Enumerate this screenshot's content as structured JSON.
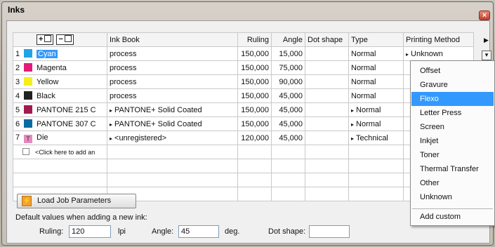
{
  "window": {
    "title": "Inks",
    "close_glyph": "×"
  },
  "toolbar": {
    "add_glyph": "+",
    "remove_glyph": "−"
  },
  "columns": {
    "ink_book": "Ink Book",
    "ruling": "Ruling",
    "angle": "Angle",
    "dot_shape": "Dot shape",
    "type": "Type",
    "printing_method": "Printing Method"
  },
  "inks": [
    {
      "num": "1",
      "name": "Cyan",
      "color": "#1fa4e6",
      "book": "process",
      "book_menu": false,
      "ruling": "150,000",
      "angle": "15,000",
      "dot_shape": "",
      "type": "Normal",
      "type_menu": false,
      "method": "Unknown",
      "method_menu": true,
      "selected": true
    },
    {
      "num": "2",
      "name": "Magenta",
      "color": "#e21b7a",
      "book": "process",
      "book_menu": false,
      "ruling": "150,000",
      "angle": "75,000",
      "dot_shape": "",
      "type": "Normal",
      "type_menu": false,
      "method": "",
      "method_menu": false,
      "selected": false
    },
    {
      "num": "3",
      "name": "Yellow",
      "color": "#f6ee1a",
      "book": "process",
      "book_menu": false,
      "ruling": "150,000",
      "angle": "90,000",
      "dot_shape": "",
      "type": "Normal",
      "type_menu": false,
      "method": "",
      "method_menu": false,
      "selected": false
    },
    {
      "num": "4",
      "name": "Black",
      "color": "#222222",
      "book": "process",
      "book_menu": false,
      "ruling": "150,000",
      "angle": "45,000",
      "dot_shape": "",
      "type": "Normal",
      "type_menu": false,
      "method": "",
      "method_menu": false,
      "selected": false
    },
    {
      "num": "5",
      "name": "PANTONE 215 C",
      "color": "#a31a52",
      "book": "PANTONE+ Solid Coated",
      "book_menu": true,
      "ruling": "150,000",
      "angle": "45,000",
      "dot_shape": "",
      "type": "Normal",
      "type_menu": true,
      "method": "",
      "method_menu": false,
      "selected": false
    },
    {
      "num": "6",
      "name": "PANTONE 307 C",
      "color": "#0a6ca3",
      "book": "PANTONE+ Solid Coated",
      "book_menu": true,
      "ruling": "150,000",
      "angle": "45,000",
      "dot_shape": "",
      "type": "Normal",
      "type_menu": true,
      "method": "",
      "method_menu": false,
      "selected": false
    },
    {
      "num": "7",
      "name": "Die",
      "color": "#e58ac0",
      "book": "<unregistered>",
      "book_menu": true,
      "ruling": "120,000",
      "angle": "45,000",
      "dot_shape": "",
      "type": "Technical",
      "type_menu": true,
      "method": "",
      "method_menu": false,
      "selected": false
    }
  ],
  "die_icon_glyph": "T",
  "add_row_hint": "<Click here to add an",
  "printing_method_menu": {
    "items": [
      "Offset",
      "Gravure",
      "Flexo",
      "Letter Press",
      "Screen",
      "Inkjet",
      "Toner",
      "Thermal Transfer",
      "Other",
      "Unknown"
    ],
    "highlighted": "Flexo",
    "add_custom": "Add custom"
  },
  "load_button": {
    "label": "Load Job Parameters",
    "icon": "lightning-icon",
    "glyph": "⚡"
  },
  "defaults": {
    "label": "Default values when adding a new ink:",
    "ruling_label": "Ruling:",
    "ruling_value": "120",
    "ruling_unit": "lpi",
    "angle_label": "Angle:",
    "angle_value": "45",
    "angle_unit": "deg.",
    "dot_shape_label": "Dot shape:",
    "dot_shape_value": ""
  },
  "colors": {
    "selection": "#3399ff",
    "close_button": "#c2412c"
  }
}
